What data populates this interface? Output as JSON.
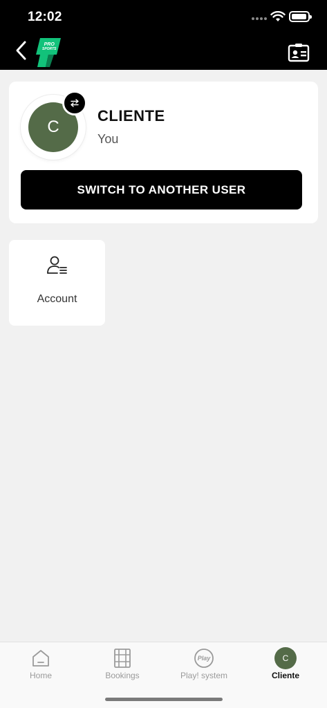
{
  "status_bar": {
    "time": "12:02"
  },
  "header": {
    "logo_text_top": "PRO",
    "logo_text_bottom": "SPORTS"
  },
  "profile": {
    "avatar_letter": "C",
    "name": "CLIENTE",
    "subtitle": "You",
    "switch_label": "SWITCH TO ANOTHER USER"
  },
  "tiles": [
    {
      "label": "Account",
      "icon": "user-list-icon"
    }
  ],
  "bottom_nav": [
    {
      "label": "Home",
      "icon": "home-icon",
      "active": false
    },
    {
      "label": "Bookings",
      "icon": "bookings-icon",
      "active": false
    },
    {
      "label": "Play! system",
      "icon": "play-icon",
      "icon_text": "Play",
      "active": false
    },
    {
      "label": "Cliente",
      "icon": "avatar",
      "avatar_letter": "C",
      "active": true
    }
  ],
  "colors": {
    "header_bg": "#000000",
    "avatar_bg": "#546b48",
    "logo_green": "#12c27a"
  }
}
